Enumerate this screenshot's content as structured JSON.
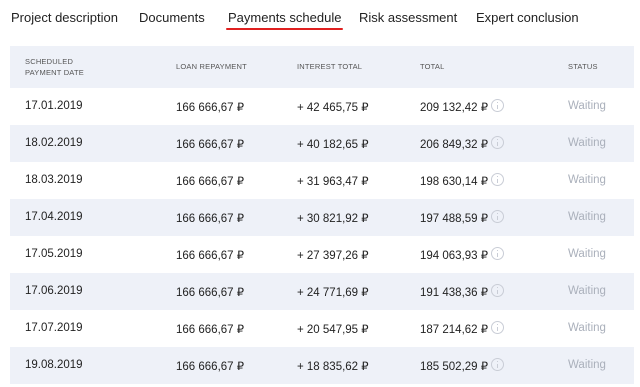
{
  "tabs": [
    {
      "label": "Project description"
    },
    {
      "label": "Documents"
    },
    {
      "label": "Payments schedule"
    },
    {
      "label": "Risk assessment"
    },
    {
      "label": "Expert conclusion"
    }
  ],
  "active_tab": "Payments schedule",
  "accent_color": "#e02020",
  "table": {
    "headers": {
      "date_line1": "SCHEDULED",
      "date_line2": "PAYMENT DATE",
      "repayment": "LOAN REPAYMENT",
      "interest": "INTEREST TOTAL",
      "total": "TOTAL",
      "status": "STATUS"
    },
    "rows": [
      {
        "date": "17.01.2019",
        "repayment": "166 666,67 ₽",
        "interest": "+ 42 465,75 ₽",
        "total": "209 132,42 ₽",
        "status": "Waiting"
      },
      {
        "date": "18.02.2019",
        "repayment": "166 666,67 ₽",
        "interest": "+ 40 182,65 ₽",
        "total": "206 849,32 ₽",
        "status": "Waiting"
      },
      {
        "date": "18.03.2019",
        "repayment": "166 666,67 ₽",
        "interest": "+ 31 963,47 ₽",
        "total": "198 630,14 ₽",
        "status": "Waiting"
      },
      {
        "date": "17.04.2019",
        "repayment": "166 666,67 ₽",
        "interest": "+ 30 821,92 ₽",
        "total": "197 488,59 ₽",
        "status": "Waiting"
      },
      {
        "date": "17.05.2019",
        "repayment": "166 666,67 ₽",
        "interest": "+ 27 397,26 ₽",
        "total": "194 063,93 ₽",
        "status": "Waiting"
      },
      {
        "date": "17.06.2019",
        "repayment": "166 666,67 ₽",
        "interest": "+ 24 771,69 ₽",
        "total": "191 438,36 ₽",
        "status": "Waiting"
      },
      {
        "date": "17.07.2019",
        "repayment": "166 666,67 ₽",
        "interest": "+ 20 547,95 ₽",
        "total": "187 214,62 ₽",
        "status": "Waiting"
      },
      {
        "date": "19.08.2019",
        "repayment": "166 666,67 ₽",
        "interest": "+ 18 835,62 ₽",
        "total": "185 502,29 ₽",
        "status": "Waiting"
      }
    ]
  }
}
